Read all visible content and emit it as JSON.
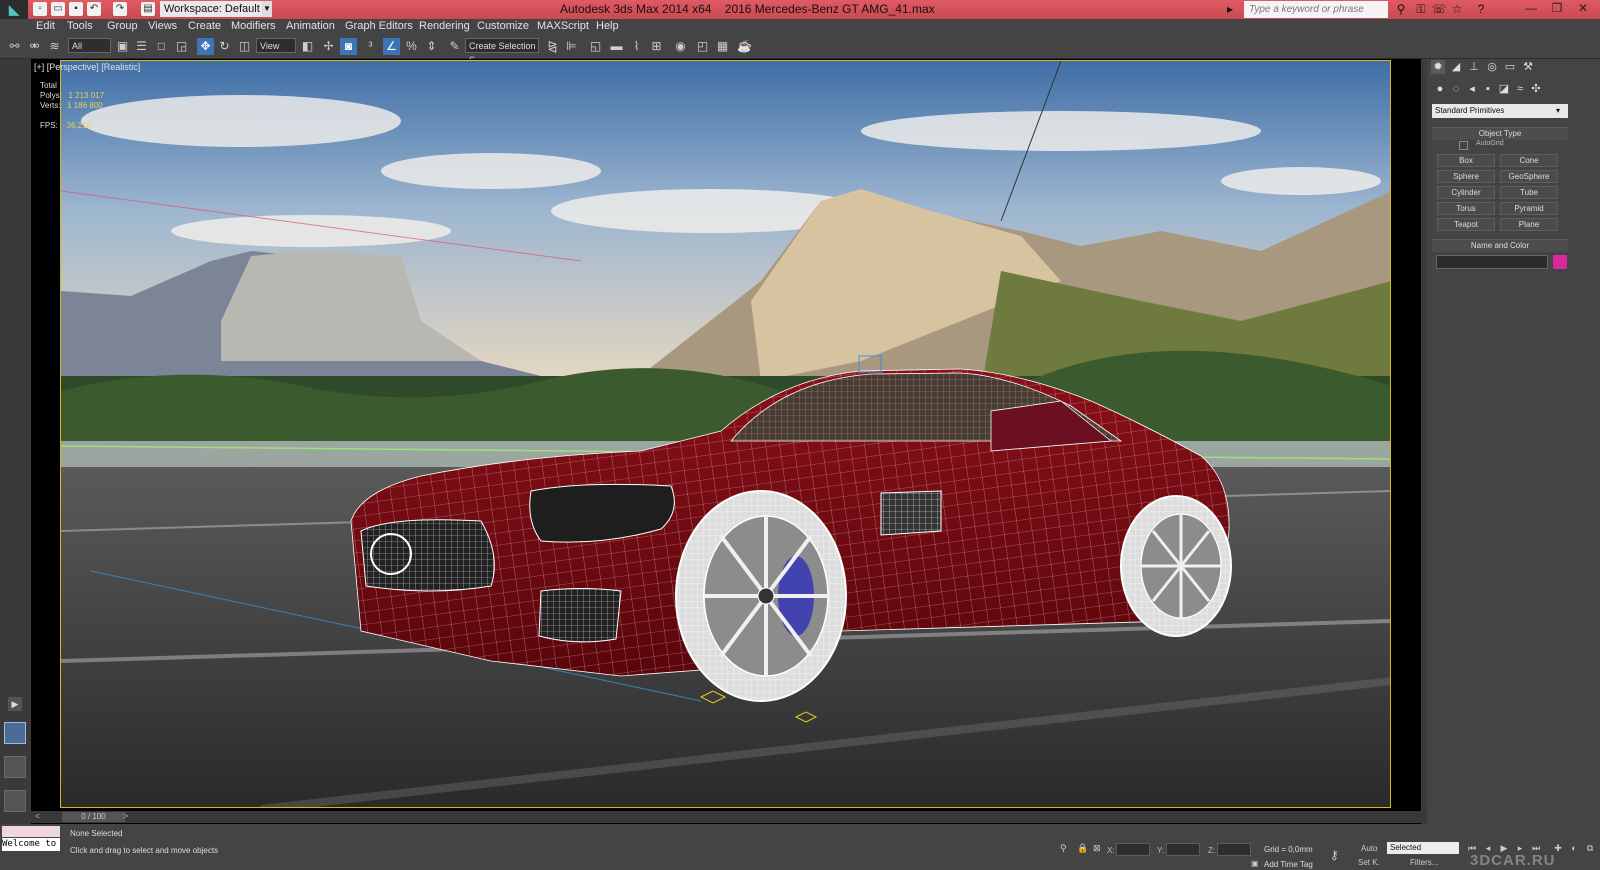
{
  "title_bar": {
    "app_name": "Autodesk 3ds Max  2014 x64",
    "file_name": "2016 Mercedes-Benz GT AMG_41.max",
    "workspace": "Workspace: Default",
    "search_placeholder": "Type a keyword or phrase"
  },
  "menu": [
    "Edit",
    "Tools",
    "Group",
    "Views",
    "Create",
    "Modifiers",
    "Animation",
    "Graph Editors",
    "Rendering",
    "Customize",
    "MAXScript",
    "Help"
  ],
  "toolbar": {
    "filter_select": "All",
    "ref_coord_select": "View",
    "selection_set": "Create Selection S"
  },
  "viewport": {
    "label": "[+] [Perspective] [Realistic]",
    "stats": {
      "total_label": "Total",
      "polys_label": "Polys:",
      "polys_value": "1 213 017",
      "verts_label": "Verts:",
      "verts_value": "1 186 800",
      "fps_label": "FPS:",
      "fps_value": "36,210"
    }
  },
  "command_panel": {
    "primitives_select": "Standard Primitives",
    "object_type_title": "Object Type",
    "autogrid": "AutoGrid",
    "buttons": [
      "Box",
      "Cone",
      "Sphere",
      "GeoSphere",
      "Cylinder",
      "Tube",
      "Torus",
      "Pyramid",
      "Teapot",
      "Plane"
    ],
    "name_color_title": "Name and Color",
    "object_color": "#d8289a"
  },
  "timeline": {
    "slider": "0 / 100"
  },
  "status": {
    "maxscript": "Welcome to MAXScript.",
    "selection": "None Selected",
    "prompt": "Click and drag to select and move objects",
    "x_label": "X:",
    "y_label": "Y:",
    "z_label": "Z:",
    "grid": "Grid = 0,0mm",
    "add_time_tag": "Add Time Tag",
    "auto_key": "Auto",
    "set_key": "Set K.",
    "selected": "Selected",
    "filters": "Filters..."
  },
  "watermark": "3DCAR.RU",
  "colors": {
    "title_bar": "#d6545c",
    "viewport_frame": "#d7b81e",
    "active_tool": "#3e74b6",
    "car_body": "#7a0d14"
  }
}
